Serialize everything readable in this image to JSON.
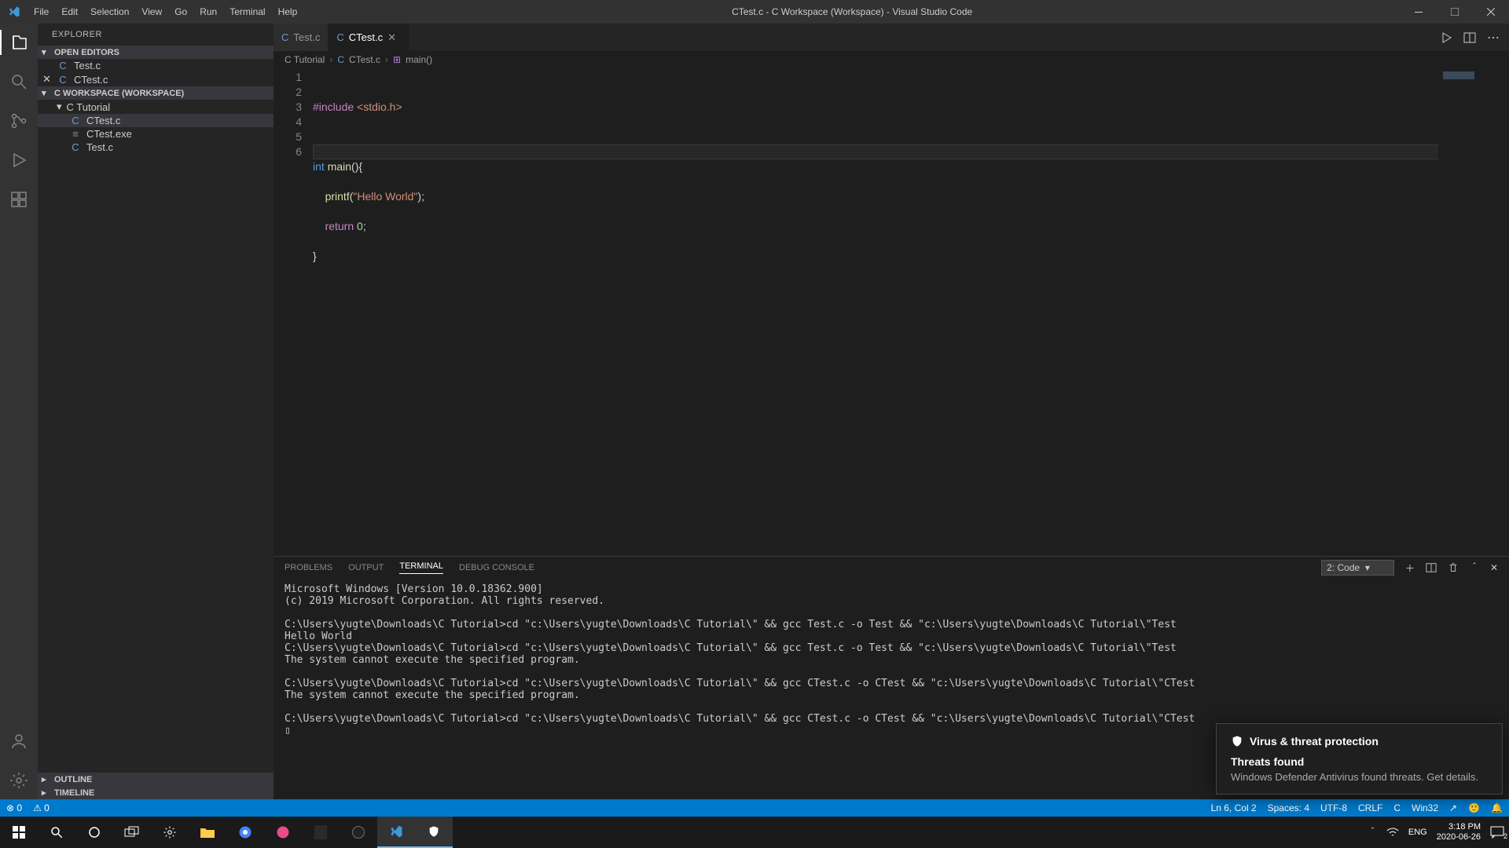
{
  "title": "CTest.c - C Workspace (Workspace) - Visual Studio Code",
  "menu": [
    "File",
    "Edit",
    "Selection",
    "View",
    "Go",
    "Run",
    "Terminal",
    "Help"
  ],
  "explorer": {
    "title": "EXPLORER",
    "openEditors": {
      "label": "OPEN EDITORS",
      "items": [
        {
          "name": "Test.c",
          "dirty": false
        },
        {
          "name": "CTest.c",
          "dirty": true
        }
      ]
    },
    "workspace": {
      "label": "C WORKSPACE (WORKSPACE)",
      "folder": "C Tutorial",
      "files": [
        {
          "name": "CTest.c",
          "kind": "c",
          "selected": true
        },
        {
          "name": "CTest.exe",
          "kind": "exe"
        },
        {
          "name": "Test.c",
          "kind": "c"
        }
      ]
    },
    "outline": "OUTLINE",
    "timeline": "TIMELINE"
  },
  "tabs": [
    {
      "name": "Test.c",
      "active": false
    },
    {
      "name": "CTest.c",
      "active": true
    }
  ],
  "breadcrumb": [
    "C Tutorial",
    "CTest.c",
    "main()"
  ],
  "code": {
    "lines": [
      "1",
      "2",
      "3",
      "4",
      "5",
      "6"
    ],
    "l1_a": "#include",
    "l1_b": "<stdio.h>",
    "l3_a": "int",
    "l3_b": "main",
    "l3_c": "(){",
    "l4_a": "printf",
    "l4_b": "(",
    "l4_c": "\"Hello World\"",
    "l4_d": ");",
    "l5_a": "return",
    "l5_b": "0",
    "l5_c": ";",
    "l6": "}"
  },
  "panel": {
    "tabs": [
      "PROBLEMS",
      "OUTPUT",
      "TERMINAL",
      "DEBUG CONSOLE"
    ],
    "active": "TERMINAL",
    "dropdown": "2: Code",
    "terminal": "Microsoft Windows [Version 10.0.18362.900]\n(c) 2019 Microsoft Corporation. All rights reserved.\n\nC:\\Users\\yugte\\Downloads\\C Tutorial>cd \"c:\\Users\\yugte\\Downloads\\C Tutorial\\\" && gcc Test.c -o Test && \"c:\\Users\\yugte\\Downloads\\C Tutorial\\\"Test\nHello World\nC:\\Users\\yugte\\Downloads\\C Tutorial>cd \"c:\\Users\\yugte\\Downloads\\C Tutorial\\\" && gcc Test.c -o Test && \"c:\\Users\\yugte\\Downloads\\C Tutorial\\\"Test\nThe system cannot execute the specified program.\n\nC:\\Users\\yugte\\Downloads\\C Tutorial>cd \"c:\\Users\\yugte\\Downloads\\C Tutorial\\\" && gcc CTest.c -o CTest && \"c:\\Users\\yugte\\Downloads\\C Tutorial\\\"CTest\nThe system cannot execute the specified program.\n\nC:\\Users\\yugte\\Downloads\\C Tutorial>cd \"c:\\Users\\yugte\\Downloads\\C Tutorial\\\" && gcc CTest.c -o CTest && \"c:\\Users\\yugte\\Downloads\\C Tutorial\\\"CTest\n▯"
  },
  "status": {
    "left": [
      "⊗ 0",
      "⚠ 0"
    ],
    "right": [
      "Ln 6, Col 2",
      "Spaces: 4",
      "UTF-8",
      "CRLF",
      "C",
      "Win32",
      "↗",
      "🙂",
      "🔔"
    ]
  },
  "notification": {
    "title": "Virus & threat protection",
    "subtitle": "Threats found",
    "body": "Windows Defender Antivirus found threats. Get details."
  },
  "systray": {
    "lang": "ENG",
    "time": "3:18 PM",
    "date": "2020-06-26",
    "count": "2"
  }
}
